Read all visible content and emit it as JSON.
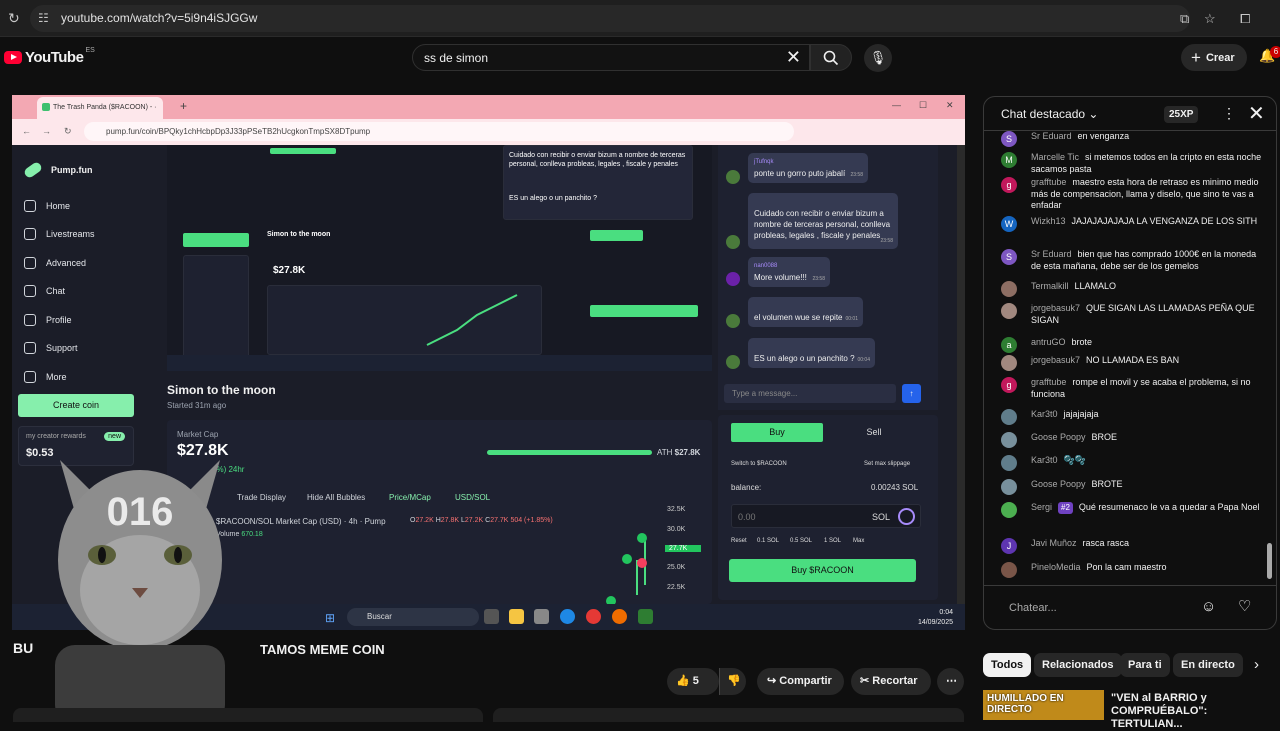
{
  "browser": {
    "url": "youtube.com/watch?v=5i9n4iSJGGw"
  },
  "youtube": {
    "logo": "YouTube",
    "region": "ES",
    "search_query": "ss de simon",
    "create_label": "Crear",
    "notif_count": "6"
  },
  "inner_browser": {
    "tab_title": "The Trash Panda ($RACOON) - ·",
    "url": "pump.fun/coin/BPQky1chHcbpDp3J33pPSeTB2hUcgkonTmpSX8DTpump"
  },
  "pumpfun": {
    "brand": "Pump.fun",
    "nav": [
      "Home",
      "Livestreams",
      "Advanced",
      "Chat",
      "Profile",
      "Support",
      "More"
    ],
    "create_coin": "Create coin",
    "rewards_label": "my creator rewards",
    "rewards_value": "$0.53",
    "rewards_badge": "new",
    "stream_title": "Simon to the moon",
    "stream_started": "Started 31m ago",
    "market_cap_label": "Market Cap",
    "market_cap_value": "$27.8K",
    "market_cap_change": "4%) 24hr",
    "ath_label": "ATH",
    "ath_value": "$27.8K",
    "chart_tools": [
      "Trade Display",
      "Hide All Bubbles",
      "Price/MCap",
      "USD/SOL"
    ],
    "chart_title": "$RACOON/SOL Market Cap (USD) · 4h · Pump",
    "ohlc": {
      "o": "27.2K",
      "h": "27.8K",
      "l": "27.2K",
      "c": "27.7K",
      "change": "504 (+1.85%)"
    },
    "volume_label": "Volume",
    "volume_value": "670.18",
    "price_ticks": [
      "32.5K",
      "30.0K",
      "27.7K",
      "25.0K",
      "22.5K"
    ],
    "chat_msgs": [
      {
        "user": "jTufnqk",
        "text": "ponte un gorro puto jabalí",
        "time": "23:58"
      },
      {
        "user": "",
        "text": "Cuidado con recibir o enviar bizum a nombre de terceras personal, conlleva probleas, legales , fiscale y penales",
        "time": "23:58"
      },
      {
        "user": "nan0088",
        "text": "More volume!!!",
        "time": "23:58"
      },
      {
        "user": "",
        "text": "el volumen wue se repite",
        "time": "00:01"
      },
      {
        "user": "",
        "text": "ES un alego o un panchito ?",
        "time": "00:04"
      }
    ],
    "chat_placeholder": "Type a message...",
    "trade": {
      "buy": "Buy",
      "sell": "Sell",
      "switch": "Switch to $RACOON",
      "slippage": "Set max slippage",
      "balance_label": "balance:",
      "balance_value": "0.00243 SOL",
      "amount": "0.00",
      "unit": "SOL",
      "presets": [
        "Reset",
        "0.1 SOL",
        "0.5 SOL",
        "1 SOL",
        "Max"
      ],
      "buy_btn": "Buy $RACOON"
    }
  },
  "taskbar": {
    "search": "Buscar",
    "time": "0:04",
    "date": "14/09/2025"
  },
  "overlay": {
    "number": "016"
  },
  "video": {
    "title_left": "BU",
    "title_right": "TAMOS MEME COIN",
    "likes": "5",
    "share": "Compartir",
    "clip": "Recortar"
  },
  "chat": {
    "header": "Chat destacado",
    "xp": "25XP",
    "input_placeholder": "Chatear...",
    "messages": [
      {
        "user": "Sr Eduard",
        "text": "en venganza",
        "avatar": "S",
        "color": "#7e57c2"
      },
      {
        "user": "Marcelle Tic",
        "text": "si metemos todos en la cripto en esta noche sacamos pasta",
        "avatar": "M",
        "color": "#2e7d32"
      },
      {
        "user": "grafftube",
        "text": "maestro esta hora de retraso es minimo medio más de compensacion, llama y diselo, que sino te vas a enfadar",
        "avatar": "g",
        "color": "#c2185b"
      },
      {
        "user": "Wizkh13",
        "text": "JAJAJAJAJAJA LA VENGANZA DE LOS SITH",
        "avatar": "W",
        "color": "#1565c0"
      },
      {
        "user": "Sr Eduard",
        "text": "bien que has comprado 1000€ en la moneda de esta mañana, debe ser de los gemelos",
        "avatar": "S",
        "color": "#7e57c2"
      },
      {
        "user": "Termalkill",
        "text": "LLAMALO",
        "avatar": "",
        "color": "#8d6e63"
      },
      {
        "user": "jorgebasuk7",
        "text": "QUE SIGAN LAS LLAMADAS PEÑA QUE SIGAN",
        "avatar": "",
        "color": "#a1887f"
      },
      {
        "user": "antruGO",
        "text": "brote",
        "avatar": "a",
        "color": "#2e7d32"
      },
      {
        "user": "jorgebasuk7",
        "text": "NO LLAMADA ES BAN",
        "avatar": "",
        "color": "#a1887f"
      },
      {
        "user": "grafftube",
        "text": "rompe el movil y se acaba el problema, si no funciona",
        "avatar": "g",
        "color": "#c2185b"
      },
      {
        "user": "Kar3t0",
        "text": "jajajajaja",
        "avatar": "",
        "color": "#607d8b"
      },
      {
        "user": "Goose Poopy",
        "text": "BROE",
        "avatar": "",
        "color": "#78909c"
      },
      {
        "user": "Kar3t0",
        "text": "🫧🫧",
        "avatar": "",
        "color": "#607d8b"
      },
      {
        "user": "Goose Poopy",
        "text": "BROTE",
        "avatar": "",
        "color": "#78909c"
      },
      {
        "user": "Sergi",
        "badge": "#2",
        "text": "Qué resumenaco le va a quedar a Papa Noel",
        "avatar": "",
        "color": "#4caf50"
      },
      {
        "user": "Javi Muñoz",
        "text": "rasca rasca",
        "avatar": "J",
        "color": "#5e35b1"
      },
      {
        "user": "PineloMedia",
        "text": "Pon la cam maestro",
        "avatar": "",
        "color": "#795548"
      }
    ]
  },
  "chips": [
    "Todos",
    "Relacionados",
    "Para ti",
    "En directo"
  ],
  "recommended": {
    "thumb_text": "HUMILLADO EN DIRECTO",
    "title": "\"VEN al BARRIO y COMPRUÉBALO\": TERTULIAN..."
  }
}
